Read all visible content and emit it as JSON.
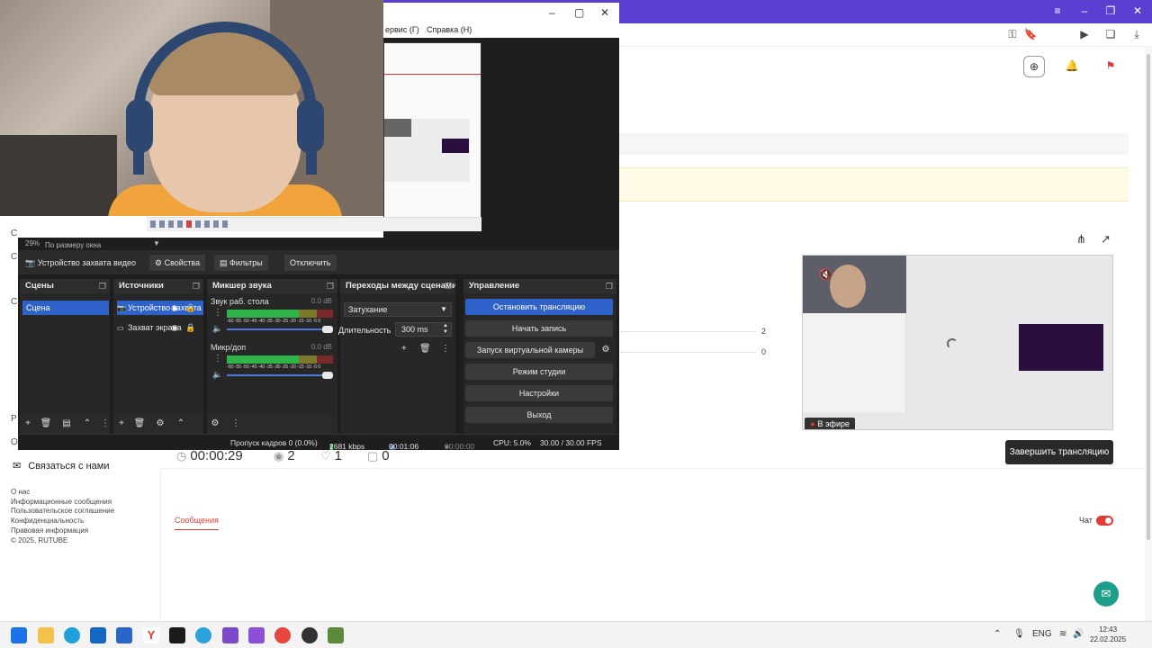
{
  "obs": {
    "menu": {
      "service": "ервис (Г)",
      "help": "Справка (Н)"
    },
    "zoom": {
      "percent": "29%",
      "mode": "По размеру окна"
    },
    "source_toolbar": {
      "source_name": "Устройство захвата видео",
      "properties": "Свойства",
      "filters": "Фильтры",
      "disable": "Отключить"
    },
    "docks": {
      "scenes": {
        "title": "Сцены",
        "items": [
          "Сцена"
        ]
      },
      "sources": {
        "title": "Источники",
        "items": [
          "Устройство захвата видео",
          "Захват экрана"
        ]
      },
      "mixer": {
        "title": "Микшер звука",
        "channels": [
          {
            "name": "Звук раб. стола",
            "db": "0.0 dB",
            "level": 0.0
          },
          {
            "name": "Микр/доп",
            "db": "0.0 dB",
            "level": 0.45
          }
        ],
        "ticks": "-60 -55 -50 -45 -40 -35 -30 -25 -20 -15 -10 -5 0"
      },
      "transitions": {
        "title": "Переходы между сценами",
        "selected": "Затухание",
        "duration_label": "Длительность",
        "duration_value": "300 ms"
      },
      "controls": {
        "title": "Управление",
        "buttons": {
          "stop_stream": "Остановить трансляцию",
          "start_record": "Начать запись",
          "virtual_cam": "Запуск виртуальной камеры",
          "studio_mode": "Режим студии",
          "settings": "Настройки",
          "exit": "Выход"
        }
      }
    },
    "status": {
      "dropped": "Пропуск кадров 0 (0.0%)",
      "bitrate": "2681 kbps",
      "stream_time": "00:01:06",
      "record_time": "00:00:00",
      "cpu": "CPU: 5.0%",
      "fps": "30.00 / 30.00 FPS"
    }
  },
  "site": {
    "stat_2": "2",
    "stat_0": "0",
    "preview": {
      "live_label": "В эфире"
    },
    "end_stream_label": "Завершить трансляцию",
    "stream_stats": {
      "duration": "00:00:29",
      "viewers": "2",
      "likes": "1",
      "comments": "0"
    },
    "contact": "Связаться с нами",
    "footer": [
      "О нас",
      "Информационные сообщения",
      "Пользовательское соглашение",
      "Конфиденциальность",
      "Правовая информация",
      "© 2025, RUTUBE"
    ],
    "messages_tab": "Сообщения",
    "chat_label": "Чат"
  },
  "taskbar": {
    "lang": "ENG",
    "time": "12:43",
    "date": "22.02.2025"
  },
  "colors": {
    "obs_accent": "#2f62c8",
    "brand_red": "#e53935",
    "browser_top": "#5a3fd0",
    "support": "#1f9d8b"
  }
}
